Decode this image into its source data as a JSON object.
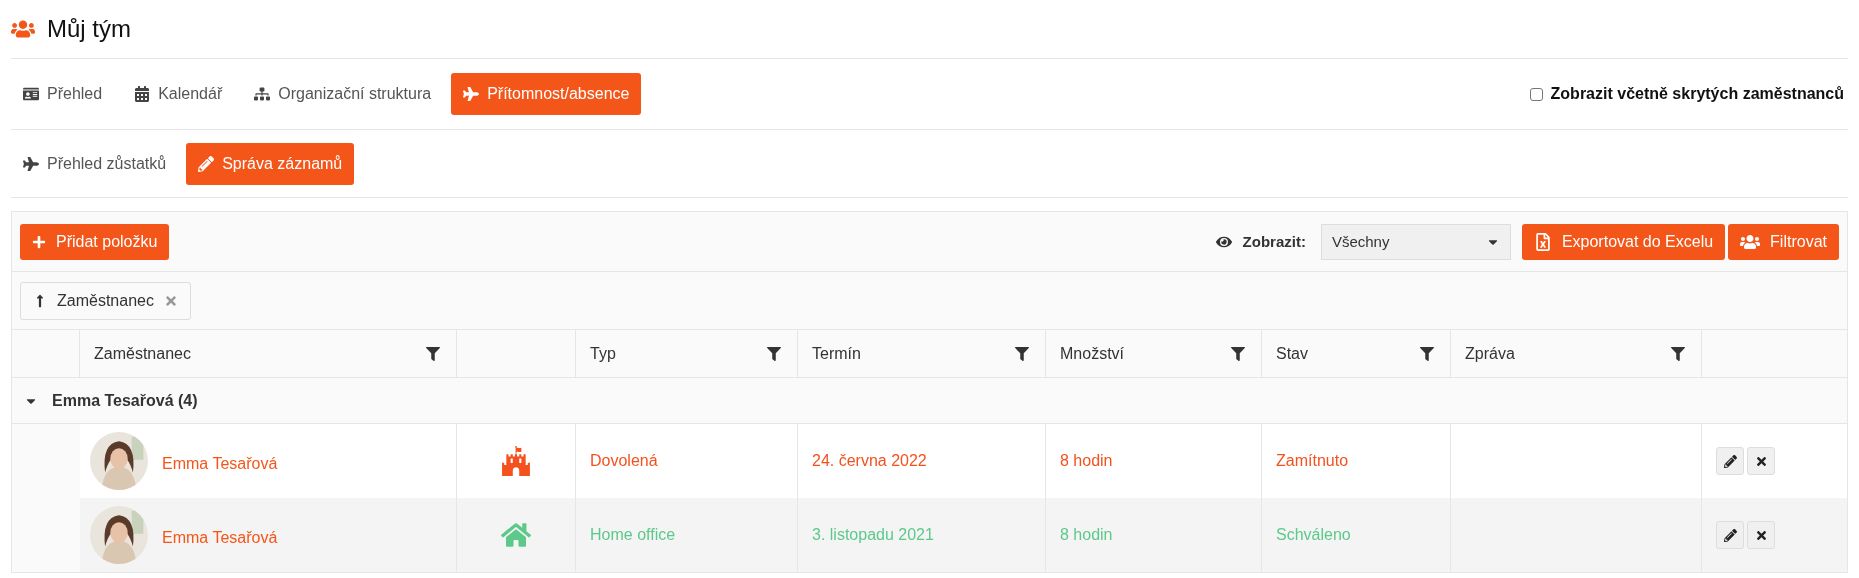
{
  "page": {
    "title": "Můj tým"
  },
  "tabs": [
    {
      "label": "Přehled",
      "kind": "card",
      "selected": false
    },
    {
      "label": "Kalendář",
      "kind": "calendar",
      "selected": false
    },
    {
      "label": "Organizační struktura",
      "kind": "tree",
      "selected": false
    },
    {
      "label": "Přítomnost/absence",
      "kind": "plane",
      "selected": true
    }
  ],
  "show_hidden": {
    "label": "Zobrazit včetně skrytých zaměstnanců",
    "checked": false
  },
  "subtabs": [
    {
      "label": "Přehled zůstatků",
      "kind": "plane",
      "selected": false
    },
    {
      "label": "Správa záznamů",
      "kind": "pencil",
      "selected": true
    }
  ],
  "toolbar": {
    "add_button": "Přidat položku",
    "show_label": "Zobrazit:",
    "show_select": {
      "value": "Všechny"
    },
    "export_button": "Exportovat do Excelu",
    "filter_button": "Filtrovat"
  },
  "group_chips": [
    {
      "label": "Zaměstnanec"
    }
  ],
  "table": {
    "columns": [
      {
        "label": "Zaměstnanec",
        "filterable": true
      },
      {
        "label": "Typ",
        "filterable": true
      },
      {
        "label": "Termín",
        "filterable": true
      },
      {
        "label": "Množství",
        "filterable": true
      },
      {
        "label": "Stav",
        "filterable": true
      },
      {
        "label": "Zpráva",
        "filterable": true
      }
    ],
    "groups": [
      {
        "label": "Emma Tesařová (4)",
        "expanded": true,
        "rows": [
          {
            "employee": "Emma Tesařová",
            "kind": "castle",
            "type": "Dovolená",
            "term": "24. června 2022",
            "amount": "8 hodin",
            "status": "Zamítnuto",
            "color": "#f4511e"
          },
          {
            "employee": "Emma Tesařová",
            "kind": "house",
            "type": "Home office",
            "term": "3. listopadu 2021",
            "amount": "8 hodin",
            "status": "Schváleno",
            "color": "#5cc98a"
          }
        ]
      }
    ]
  }
}
